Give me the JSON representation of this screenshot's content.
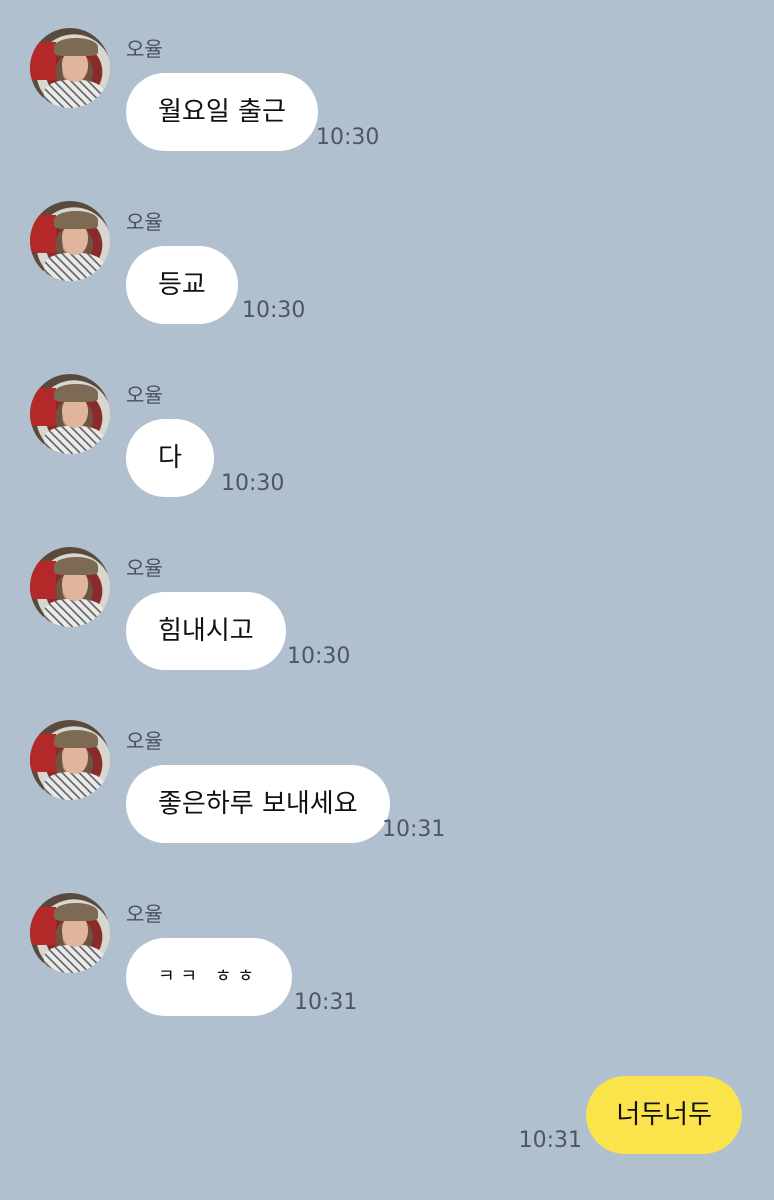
{
  "messages": [
    {
      "sender": "오율",
      "text": "월요일 출근",
      "time": "10:30"
    },
    {
      "sender": "오율",
      "text": "등교",
      "time": "10:30"
    },
    {
      "sender": "오율",
      "text": "다",
      "time": "10:30"
    },
    {
      "sender": "오율",
      "text": "힘내시고",
      "time": "10:30"
    },
    {
      "sender": "오율",
      "text": "좋은하루 보내세요",
      "time": "10:31"
    },
    {
      "sender": "오율",
      "text": "ㅋㅋ ㅎㅎ",
      "time": "10:31"
    }
  ],
  "my_message": {
    "text": "너두너두",
    "time": "10:31"
  },
  "colors": {
    "background": "#b1c0ce",
    "incoming_bubble": "#ffffff",
    "outgoing_bubble": "#fae34b"
  },
  "icons": {
    "avatar": "profile-photo-avatar"
  }
}
